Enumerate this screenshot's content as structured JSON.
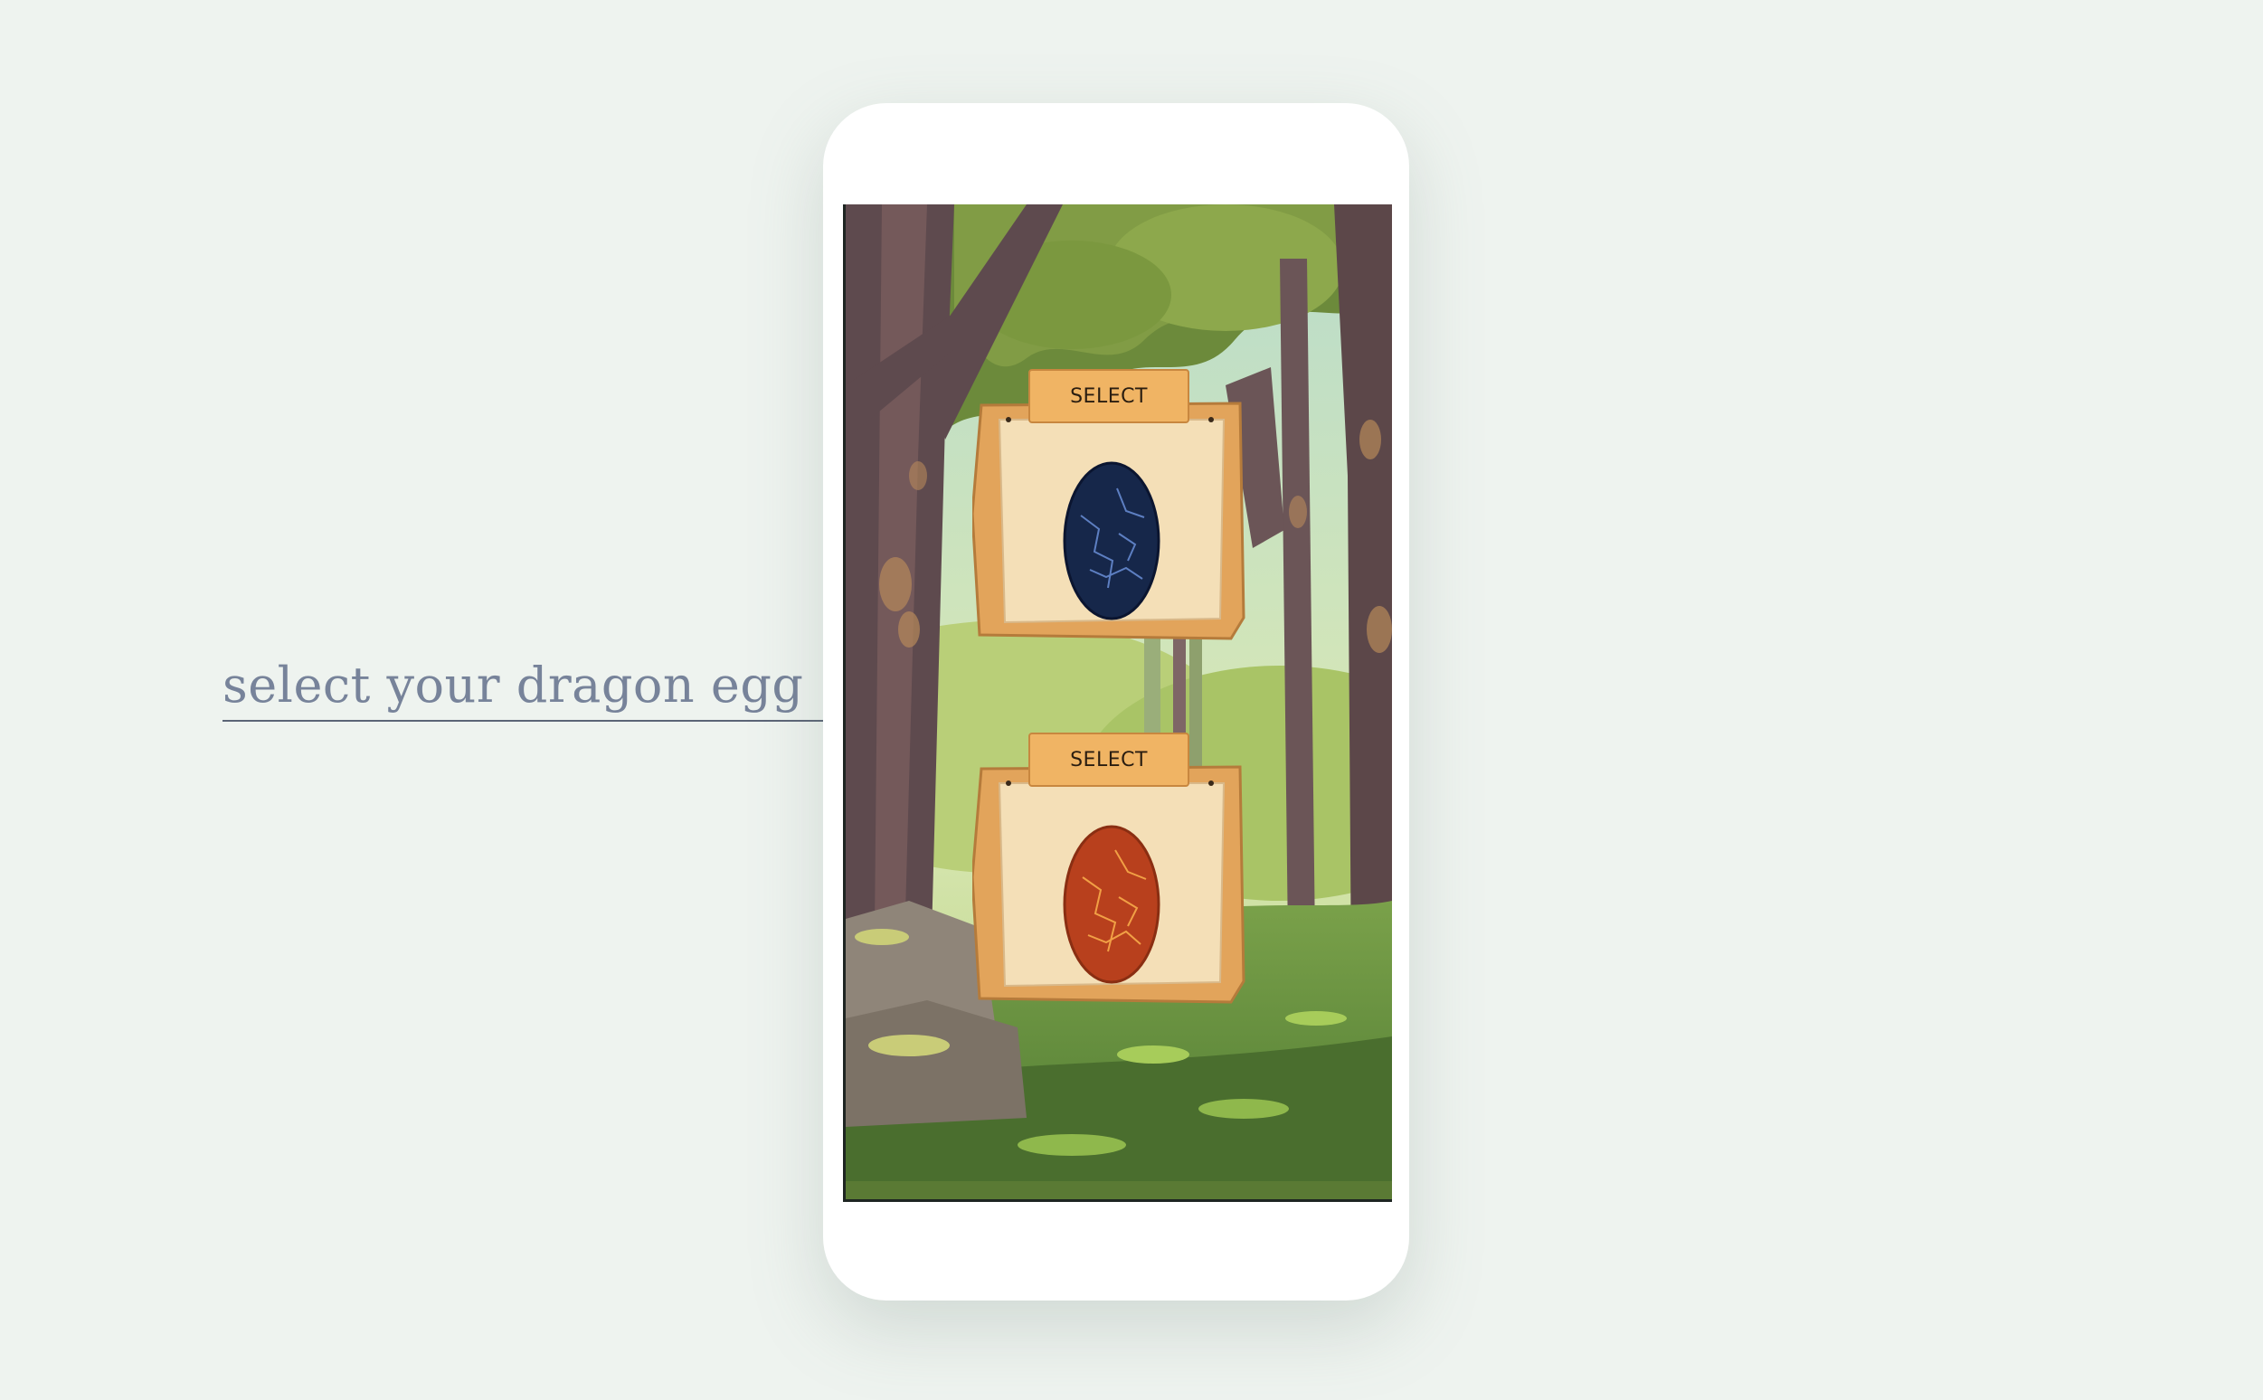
{
  "annotation": {
    "text": "select your dragon egg"
  },
  "eggs": [
    {
      "button_label": "SELECT",
      "egg_name": "blue-egg-icon",
      "color": "#16274a",
      "vein": "#5d7fc2"
    },
    {
      "button_label": "SELECT",
      "egg_name": "red-egg-icon",
      "color": "#b8401d",
      "vein": "#f1a045"
    }
  ],
  "colors": {
    "background": "#eef3ef",
    "phone": "#ffffff",
    "wood": "#e9a85a",
    "parchment": "#f4dfb7",
    "annotation_text": "#77839a"
  }
}
